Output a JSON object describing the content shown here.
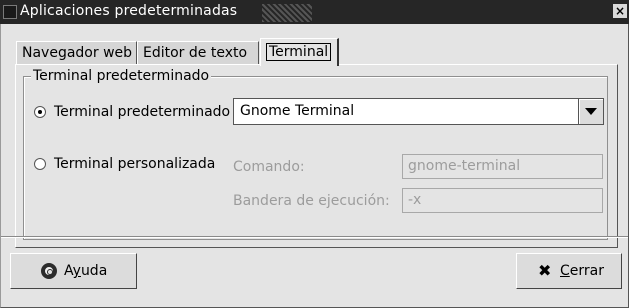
{
  "window": {
    "title": "Aplicaciones predeterminadas",
    "close_glyph": "×"
  },
  "tabs": [
    {
      "label": "Navegador web",
      "active": false
    },
    {
      "label": "Editor de texto",
      "active": false
    },
    {
      "label": "Terminal",
      "active": true
    }
  ],
  "terminal_frame": {
    "legend": "Terminal predeterminado",
    "option_default": {
      "label": "Terminal predeterminado",
      "selected": true,
      "combo_value": "Gnome Terminal",
      "combo_icon": "chevron-down-icon"
    },
    "option_custom": {
      "label": "Terminal personalizada",
      "selected": false,
      "command_label": "Comando:",
      "command_value": "gnome-terminal",
      "exec_flag_label": "Bandera de ejecución:",
      "exec_flag_value": "-x"
    }
  },
  "buttons": {
    "help": {
      "prefix": "A",
      "mnemonic": "y",
      "suffix": "uda",
      "icon": "lifebuoy-icon"
    },
    "close": {
      "mnemonic": "C",
      "suffix": "errar",
      "icon": "close-x-icon",
      "glyph": "✖"
    }
  }
}
